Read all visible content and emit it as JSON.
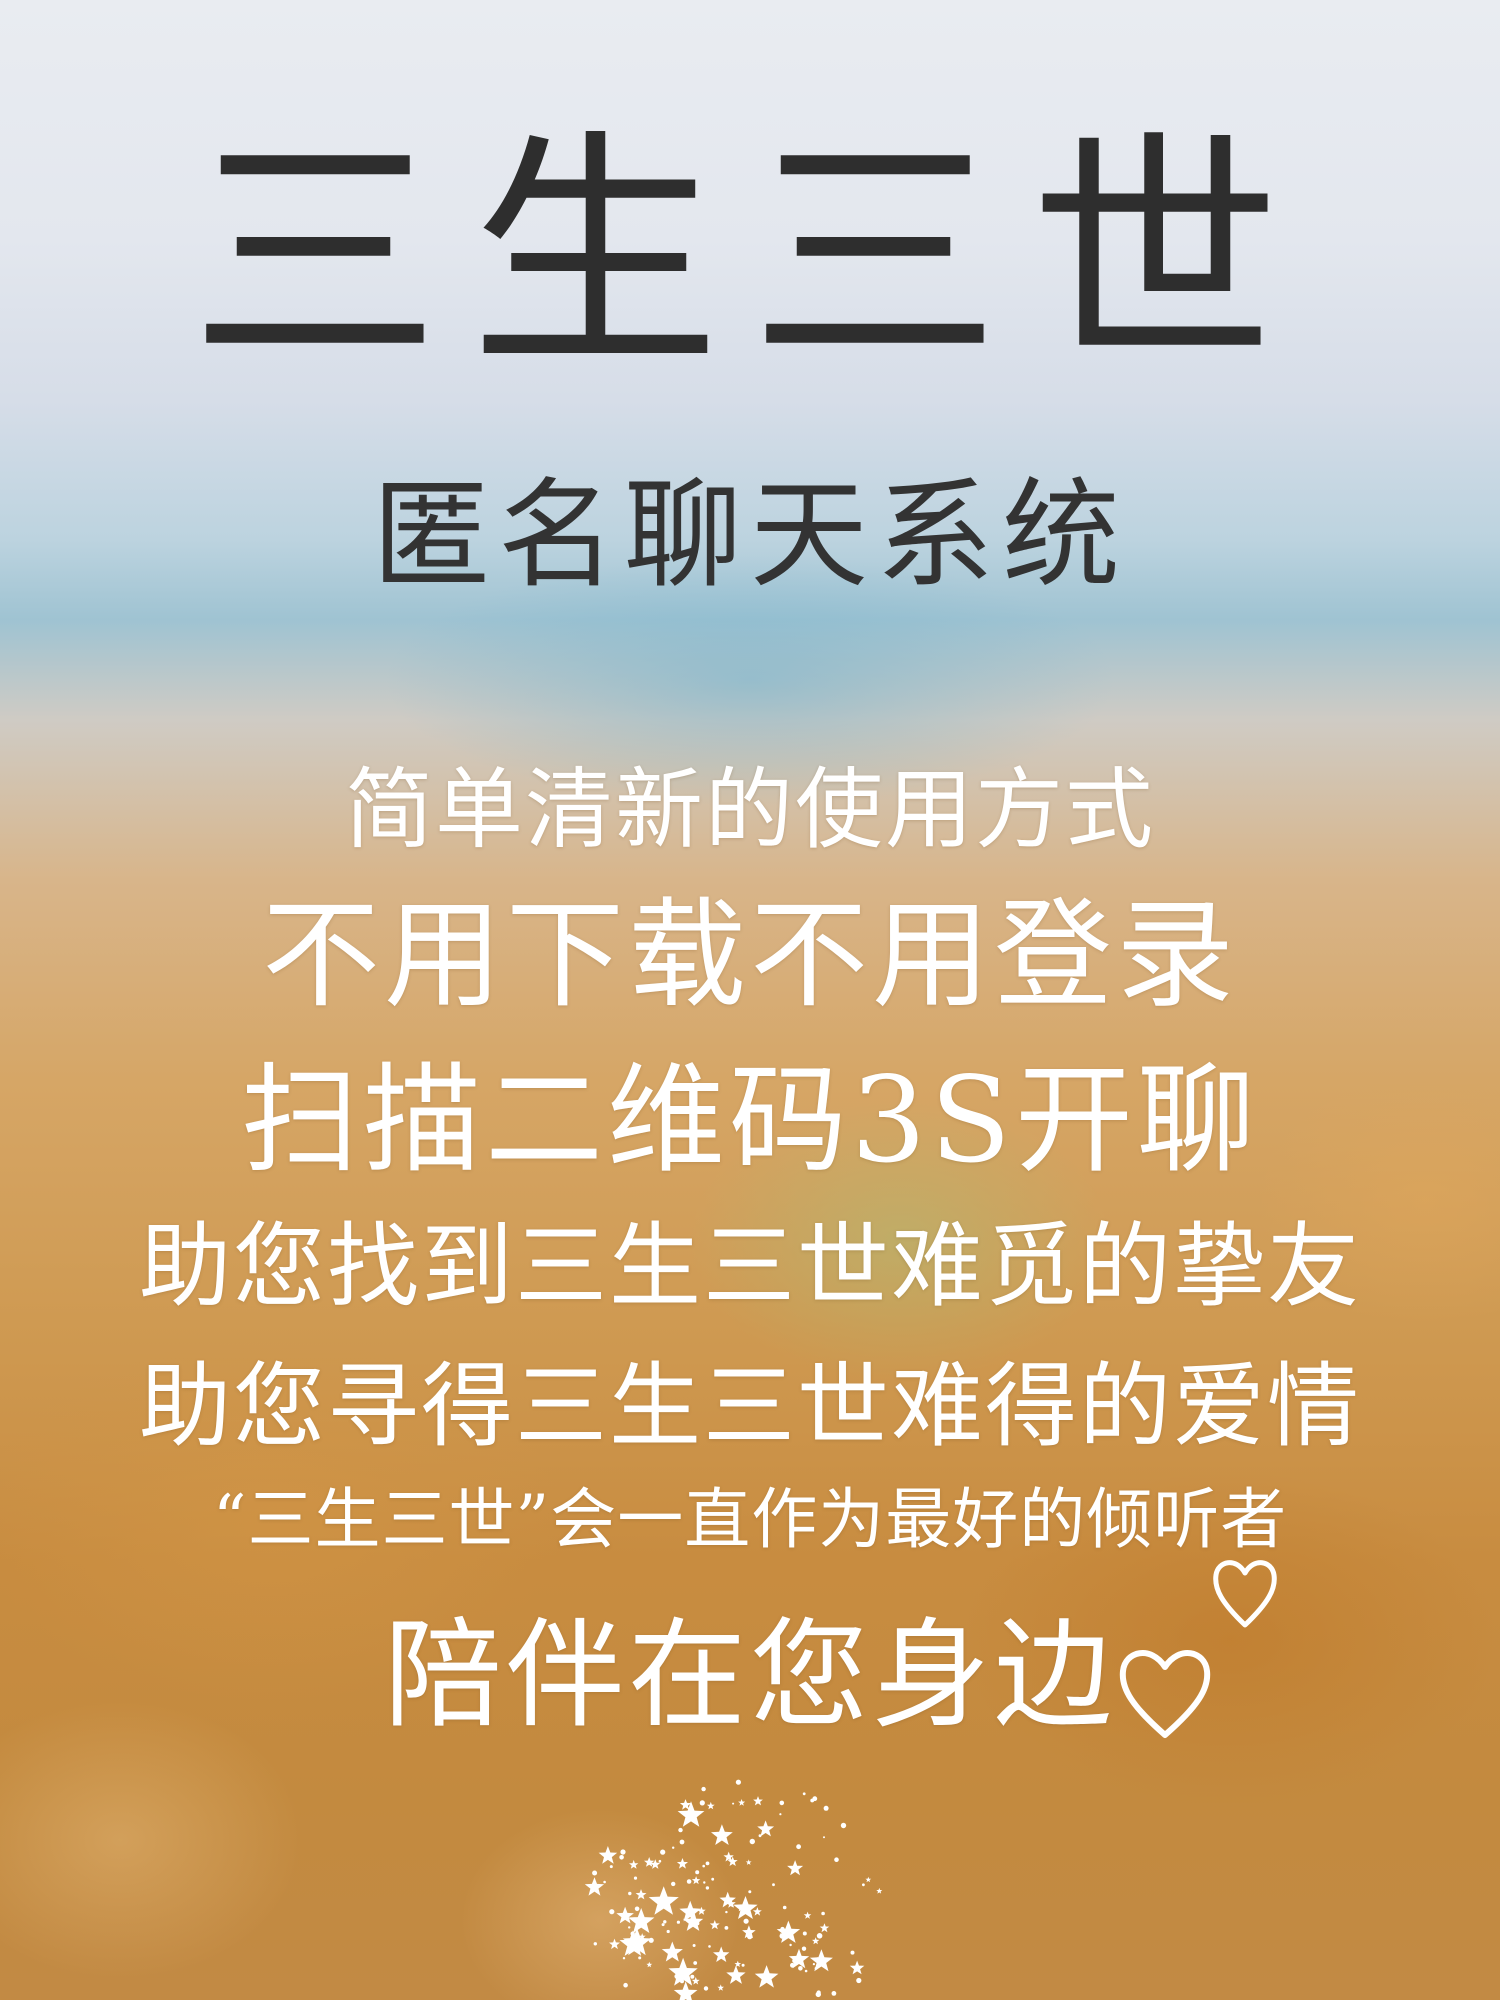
{
  "title": "三生三世",
  "subtitle": "匿名聊天系统",
  "lines": [
    "简单清新的使用方式",
    "不用下载不用登录",
    "扫描二维码3S开聊",
    "助您找到三生三世难觅的挚友",
    "助您寻得三生三世难得的爱情",
    "“三生三世”会一直作为最好的倾听者",
    "陪伴在您身边"
  ],
  "icons": {
    "heart_small": "heart-outline-icon",
    "heart_big": "heart-outline-icon",
    "sparkles": "stars-sparkle-icon"
  },
  "colors": {
    "title": "#2e2e2e",
    "subtitle": "#333333",
    "body_text": "#ffffff",
    "sky": "#e3e7ee",
    "field": "#cf9a52"
  }
}
